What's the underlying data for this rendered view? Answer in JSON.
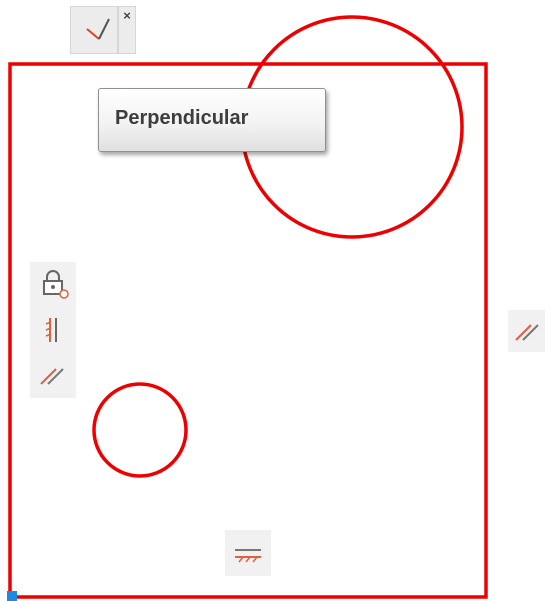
{
  "tooltip": {
    "text": "Perpendicular"
  },
  "constraint_toolbar": {
    "active_tool_icon": "perpendicular-icon",
    "close_glyph": "×"
  },
  "left_constraint_panel": {
    "icons": [
      "fix-lock-icon",
      "collinear-icon",
      "parallel-icon"
    ]
  },
  "side_constraint_icon": "parallel-icon",
  "bottom_constraint_icon": "horizontal-icon",
  "colors": {
    "sketch_geometry": "#ee0000",
    "constraint_glyph": "#e06040",
    "selection_handle": "#1e88e5"
  }
}
